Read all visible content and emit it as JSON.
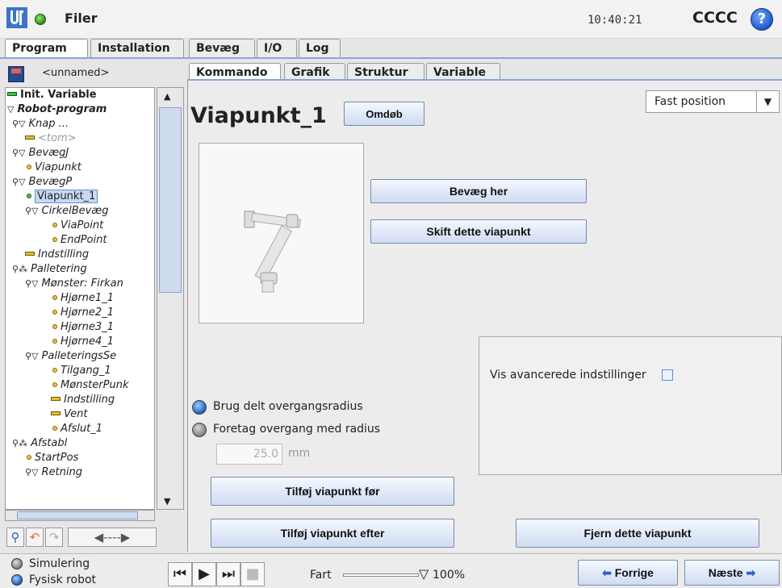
{
  "titlebar": {
    "app_label": "Filer",
    "clock": "10:40:21",
    "robot_name": "CCCC",
    "help": "?"
  },
  "main_tabs": [
    "Program",
    "Installation",
    "Bevæg",
    "I/O",
    "Log"
  ],
  "sub_tabs": [
    "Kommando",
    "Grafik",
    "Struktur",
    "Variable"
  ],
  "file": {
    "name": "<unnamed>"
  },
  "tree": [
    {
      "label": "Init. Variable",
      "style": "bold",
      "icon": "green-bar"
    },
    {
      "label": "Robot-program",
      "style": "bold-italic",
      "icon": "triangle"
    },
    {
      "label": "Knap ...",
      "style": "italic",
      "icon": "triangle"
    },
    {
      "label": "<tom>",
      "style": "italic-grey",
      "icon": "yellow-bar"
    },
    {
      "label": "BevægJ",
      "style": "italic",
      "icon": "triangle"
    },
    {
      "label": "Viapunkt",
      "style": "italic",
      "icon": "yellow-dot"
    },
    {
      "label": "BevægP",
      "style": "italic",
      "icon": "triangle"
    },
    {
      "label": "Viapunkt_1",
      "style": "selected",
      "icon": "green-dot"
    },
    {
      "label": "CirkelBevæg",
      "style": "italic",
      "icon": "triangle"
    },
    {
      "label": "ViaPoint",
      "style": "italic",
      "icon": "yellow-dot"
    },
    {
      "label": "EndPoint",
      "style": "italic",
      "icon": "yellow-dot"
    },
    {
      "label": "Indstilling",
      "style": "italic",
      "icon": "yellow-bar"
    },
    {
      "label": "Palletering",
      "style": "italic",
      "icon": "pallet"
    },
    {
      "label": "Mønster: Firkan",
      "style": "italic",
      "icon": "triangle"
    },
    {
      "label": "Hjørne1_1",
      "style": "italic",
      "icon": "yellow-dot"
    },
    {
      "label": "Hjørne2_1",
      "style": "italic",
      "icon": "yellow-dot"
    },
    {
      "label": "Hjørne3_1",
      "style": "italic",
      "icon": "yellow-dot"
    },
    {
      "label": "Hjørne4_1",
      "style": "italic",
      "icon": "yellow-dot"
    },
    {
      "label": "PalleteringsSe",
      "style": "italic",
      "icon": "triangle"
    },
    {
      "label": "Tilgang_1",
      "style": "italic",
      "icon": "yellow-dot"
    },
    {
      "label": "MønsterPunk",
      "style": "italic",
      "icon": "yellow-dot"
    },
    {
      "label": "Indstilling",
      "style": "italic",
      "icon": "yellow-bar"
    },
    {
      "label": "Vent",
      "style": "italic",
      "icon": "yellow-bar"
    },
    {
      "label": "Afslut_1",
      "style": "italic",
      "icon": "yellow-dot"
    },
    {
      "label": "Afstabl",
      "style": "italic",
      "icon": "pallet"
    },
    {
      "label": "StartPos",
      "style": "italic",
      "icon": "yellow-dot"
    },
    {
      "label": "Retning",
      "style": "italic",
      "icon": "triangle"
    }
  ],
  "waypoint": {
    "title": "Viapunkt_1",
    "rename_label": "Omdøb",
    "position_type": "Fast position",
    "move_here_label": "Bevæg her",
    "change_label": "Skift dette viapunkt",
    "advanced_label": "Vis avancerede indstillinger",
    "radio_shared": "Brug delt overgangsradius",
    "radio_radius": "Foretag overgang med radius",
    "radius_value": "25.0",
    "radius_unit": "mm",
    "add_before_label": "Tilføj viapunkt før",
    "add_after_label": "Tilføj viapunkt efter",
    "remove_label": "Fjern dette viapunkt"
  },
  "bottom": {
    "simulation_label": "Simulering",
    "real_robot_label": "Fysisk robot",
    "speed_label": "Fart",
    "speed_value": "100%",
    "speed_fraction": 1.0,
    "prev_label": "Forrige",
    "next_label": "Næste"
  },
  "colors": {
    "accent": "#8aa6d6",
    "button_top": "#f4f8ff",
    "button_bottom": "#cfdcf2",
    "selected_bg": "#c8d8f4"
  }
}
